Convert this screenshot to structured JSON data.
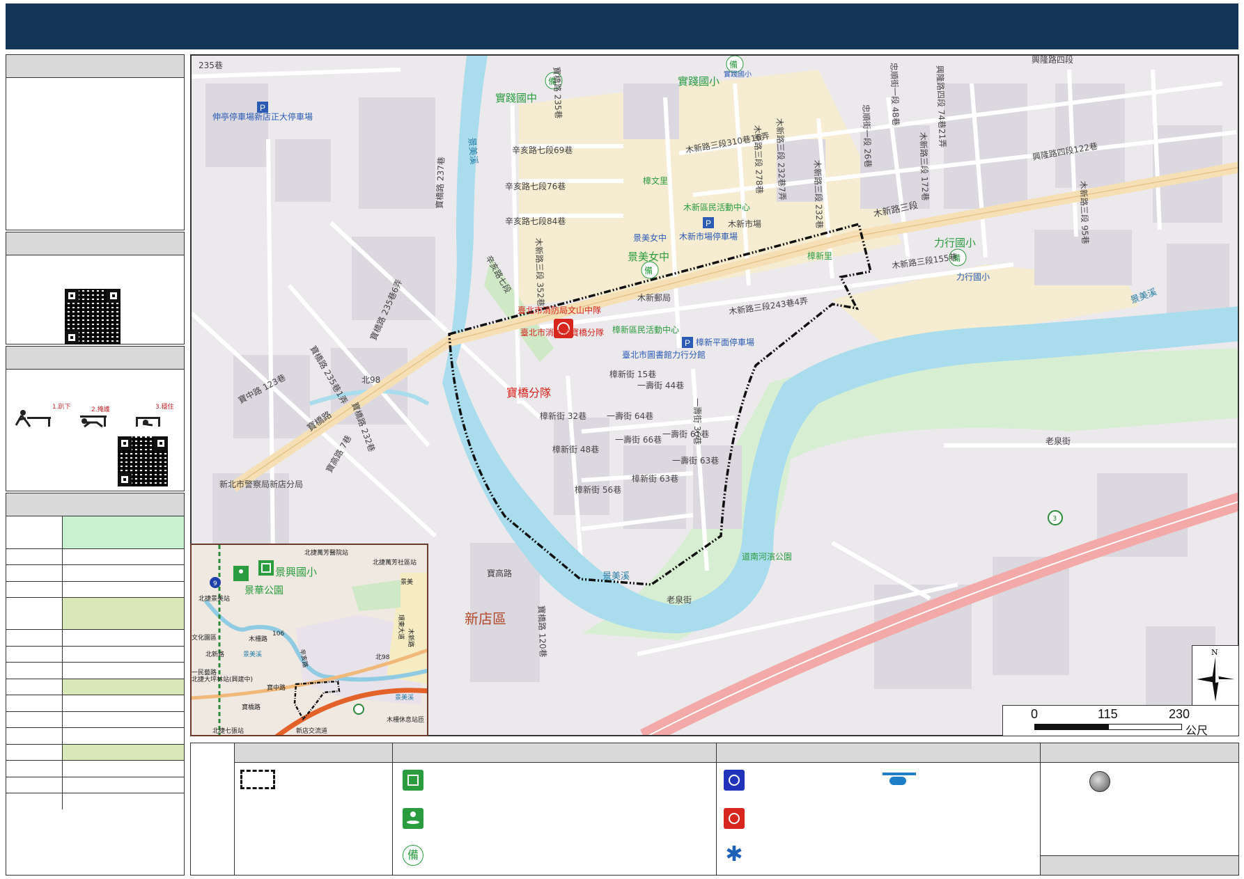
{
  "title": "",
  "colors": {
    "title_bar": "#143558",
    "river": "#a9dcec",
    "main_road": "#f6dfb4",
    "expressway": "#f2a9a7",
    "school_area": "#f5ecd1",
    "park": "#cfe8c6",
    "boundary": "#111111",
    "station_red": "#d7261e",
    "shelter_green": "#2a9b3e"
  },
  "map": {
    "district_label": "新店區",
    "highlight_label": "寶橋分隊",
    "labels": {
      "l1": "235巷",
      "l2": "伸亭停車場新店正大停車場",
      "l3": "寶橋路 237巷",
      "l4": "景美溪",
      "l5": "實踐國中",
      "l6": "實踐國小",
      "l7": "實踐國小",
      "l8": "木新路三段310巷16弄",
      "l9": "辛亥路七段69巷",
      "l10": "辛亥路七段76巷",
      "l11": "辛亥路七段84巷",
      "l12": "樟文里",
      "l13": "木新區民活動中心",
      "l14": "木新市場",
      "l15": "木新市場停車場",
      "l16": "景美女中",
      "l17": "景美女中",
      "l18": "木新路三段",
      "l19": "力行國小",
      "l20": "力行國小",
      "l21": "木新路三段155巷",
      "l22": "興隆路四段122巷",
      "l23": "樟新里",
      "l24": "木新郵局",
      "l25": "臺北市消防局文山中隊",
      "l26": "臺北市消防局寶橋分隊",
      "l27": "木新路三段243巷4弄",
      "l28": "樟新區民活動中心",
      "l29": "樟新平面停車場",
      "l30": "臺北市圖書館力行分館",
      "l31": "樟新街 15巷",
      "l32": "一壽街 44巷",
      "l33": "寶中路 123巷",
      "l34": "寶橋路 235巷1弄",
      "l35": "寶橋路 235巷6弄",
      "l36": "北98",
      "l37": "寶橋路",
      "l38": "寶橋路 232巷",
      "l39": "樟新街 32巷",
      "l40": "一壽街 64巷",
      "l41": "樟新街 48巷",
      "l42": "一壽街 66巷",
      "l43": "一壽街 61巷",
      "l44": "一壽街 63巷",
      "l45": "樟新街 56巷",
      "l46": "樟新街 63巷",
      "l47": "一壽街 36巷",
      "l48": "老泉街",
      "l49": "景美溪",
      "l50": "道南河濱公園",
      "l51": "景美溪",
      "l52": "老泉街",
      "l53": "寶高路",
      "l54": "寶橋路 120巷",
      "l55": "新北市警察局新店分局",
      "l56": "寶高路 7巷",
      "l57": "木新路三段 95巷",
      "l58": "興隆路四段 74巷21弄",
      "l59": "興隆路四段",
      "l60": "木新路三段 232巷",
      "l61": "木新路三段 278巷",
      "l62": "木新路三段 232巷7弄",
      "l63": "木新路三段 172巷",
      "l64": "忠順街一段 26巷",
      "l65": "忠順街一段 48巷",
      "l66": "木新路三段 352巷",
      "l67": "辛亥路七段",
      "l68": "寶橋路 235巷"
    }
  },
  "inset": {
    "labels": {
      "i1": "北捷萬芳醫院站",
      "i2": "北捷萬芳社區站",
      "i3": "景興國小",
      "i4": "景華公園",
      "i5": "北捷景美站",
      "i6": "木新路",
      "i7": "木柵路",
      "i8": "北新路",
      "i9": "文化園區",
      "i10": "一民藝路",
      "i11": "景美溪",
      "i12": "北98",
      "i13": "寶中路",
      "i14": "寶橋路",
      "i15": "北捷七張站",
      "i16": "新店交流道",
      "i17": "木柵休息站匝",
      "i18": "辛亥路",
      "i19": "106",
      "i20": "環東大道",
      "i21": "景美溪",
      "i22": "景美",
      "i23": "北捷大坪林站(興建中)"
    }
  },
  "scale": {
    "t0": "0",
    "t1": "115",
    "t2": "230",
    "unit": "公尺"
  },
  "compass": {
    "north": "N"
  },
  "sidebar": {
    "evac_action_1": "1.趴下",
    "evac_action_2": "2.掩護",
    "evac_action_3": "3.穩住"
  },
  "icons": {
    "boundary": "dashed-boundary-icon",
    "shelter": "shelter-house-icon",
    "evac_point": "evacuation-point-icon",
    "standby": "standby-mark-icon",
    "police": "police-badge-icon",
    "fire": "fire-station-icon",
    "ems": "star-of-life-icon",
    "helicopter": "helicopter-icon",
    "aed": "aed-circle-icon"
  }
}
